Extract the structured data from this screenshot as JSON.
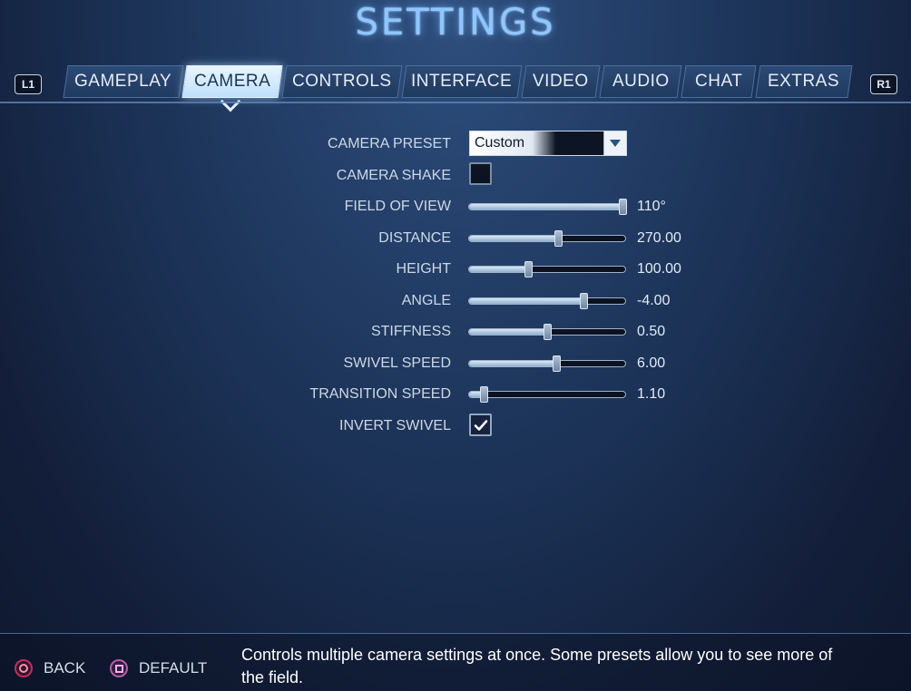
{
  "title": "SETTINGS",
  "bumpers": {
    "left": "L1",
    "right": "R1"
  },
  "tabs": [
    {
      "label": "GAMEPLAY",
      "active": false
    },
    {
      "label": "CAMERA",
      "active": true
    },
    {
      "label": "CONTROLS",
      "active": false
    },
    {
      "label": "INTERFACE",
      "active": false
    },
    {
      "label": "VIDEO",
      "active": false
    },
    {
      "label": "AUDIO",
      "active": false
    },
    {
      "label": "CHAT",
      "active": false
    },
    {
      "label": "EXTRAS",
      "active": false
    }
  ],
  "settings": {
    "camera_preset": {
      "label": "CAMERA PRESET",
      "value": "Custom"
    },
    "camera_shake": {
      "label": "CAMERA SHAKE",
      "checked": false
    },
    "field_of_view": {
      "label": "FIELD OF VIEW",
      "value": "110°",
      "level": 1.0
    },
    "distance": {
      "label": "DISTANCE",
      "value": "270.00",
      "level": 0.57
    },
    "height": {
      "label": "HEIGHT",
      "value": "100.00",
      "level": 0.38
    },
    "angle": {
      "label": "ANGLE",
      "value": "-4.00",
      "level": 0.73
    },
    "stiffness": {
      "label": "STIFFNESS",
      "value": "0.50",
      "level": 0.5
    },
    "swivel_speed": {
      "label": "SWIVEL SPEED",
      "value": "6.00",
      "level": 0.56
    },
    "transition_speed": {
      "label": "TRANSITION SPEED",
      "value": "1.10",
      "level": 0.1
    },
    "invert_swivel": {
      "label": "INVERT SWIVEL",
      "checked": true
    }
  },
  "footer": {
    "back_label": "BACK",
    "default_label": "DEFAULT",
    "description": "Controls multiple camera settings at once. Some presets allow you to see more of the field."
  },
  "colors": {
    "accent": "#8fc6ff",
    "active_tab": "#e9f5ff",
    "back_button": "#c0305a",
    "default_button": "#b85ea8"
  }
}
